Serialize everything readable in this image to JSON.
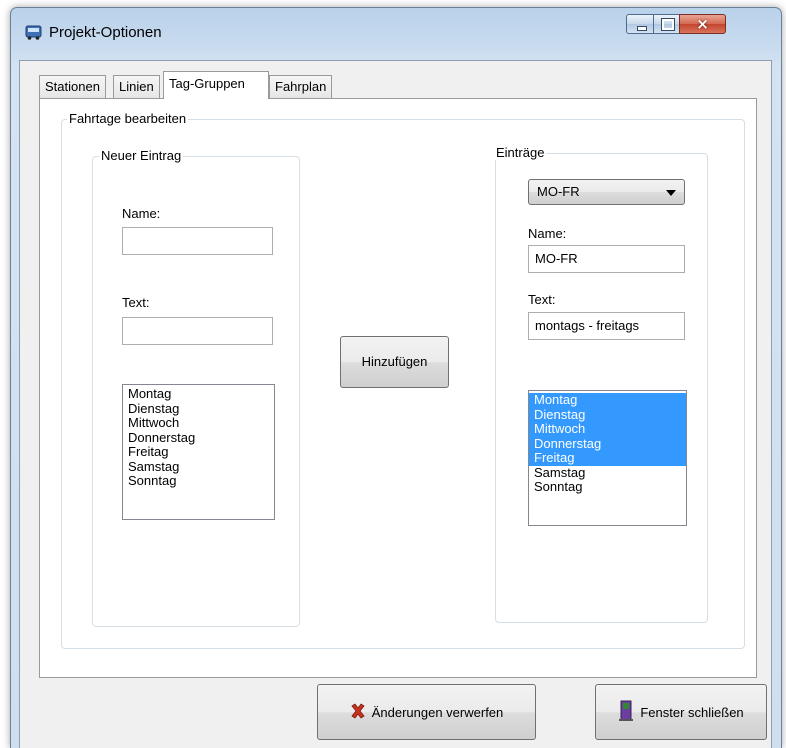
{
  "window": {
    "title": "Projekt-Optionen",
    "icon": "bus-icon",
    "controls": {
      "minimize": "minimize-icon",
      "maximize": "maximize-icon",
      "close": "×"
    }
  },
  "tabs": [
    {
      "label": "Stationen",
      "active": false
    },
    {
      "label": "Linien",
      "active": false
    },
    {
      "label": "Tag-Gruppen",
      "active": true
    },
    {
      "label": "Fahrplan",
      "active": false
    }
  ],
  "main": {
    "group_title": "Fahrtage bearbeiten",
    "new_entry": {
      "title": "Neuer Eintrag",
      "name_label": "Name:",
      "name_value": "",
      "text_label": "Text:",
      "text_value": "",
      "days": [
        "Montag",
        " Dienstag",
        " Mittwoch",
        " Donnerstag",
        " Freitag",
        " Samstag",
        " Sonntag"
      ]
    },
    "add_button": "Hinzufügen",
    "entries": {
      "title": "Einträge",
      "selected": "MO-FR",
      "name_label": "Name:",
      "name_value": "MO-FR",
      "text_label": "Text:",
      "text_value": "montags - freitags",
      "days": [
        {
          "label": "Montag",
          "selected": true
        },
        {
          "label": " Dienstag",
          "selected": true
        },
        {
          "label": " Mittwoch",
          "selected": true
        },
        {
          "label": " Donnerstag",
          "selected": true
        },
        {
          "label": " Freitag",
          "selected": true
        },
        {
          "label": " Samstag",
          "selected": false
        },
        {
          "label": " Sonntag",
          "selected": false
        }
      ]
    }
  },
  "footer": {
    "discard_button": "Änderungen verwerfen",
    "discard_icon": "red-x-icon",
    "close_button": "Fenster schließen",
    "close_icon": "door-exit-icon"
  },
  "colors": {
    "selection": "#3399ff",
    "close_button": "#c4452c",
    "discard_icon": "#c8321e"
  }
}
